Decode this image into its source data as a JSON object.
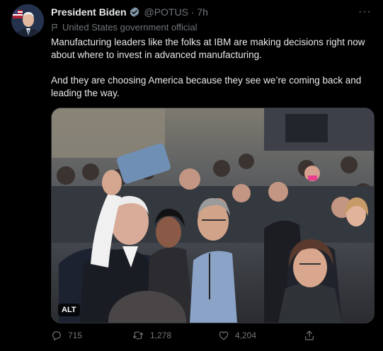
{
  "tweet": {
    "author_name": "President Biden",
    "handle": "@POTUS",
    "separator": "·",
    "time": "7h",
    "more_label": "···",
    "account_label": "United States government official",
    "paragraphs": [
      "Manufacturing leaders like the folks at IBM are making decisions right now about where to invest in advanced manufacturing.",
      "And they are choosing America because they see we’re coming back and leading the way."
    ],
    "media": {
      "alt_badge": "ALT"
    }
  },
  "actions": {
    "replies": "715",
    "retweets": "1,278",
    "likes": "4,204",
    "icons": [
      "reply-icon",
      "retweet-icon",
      "like-icon",
      "share-icon"
    ]
  },
  "colors": {
    "background": "#000000",
    "text_primary": "#e7e9ea",
    "text_secondary": "#71767b",
    "verified_badge": "#829aab",
    "border": "#2f3336"
  }
}
